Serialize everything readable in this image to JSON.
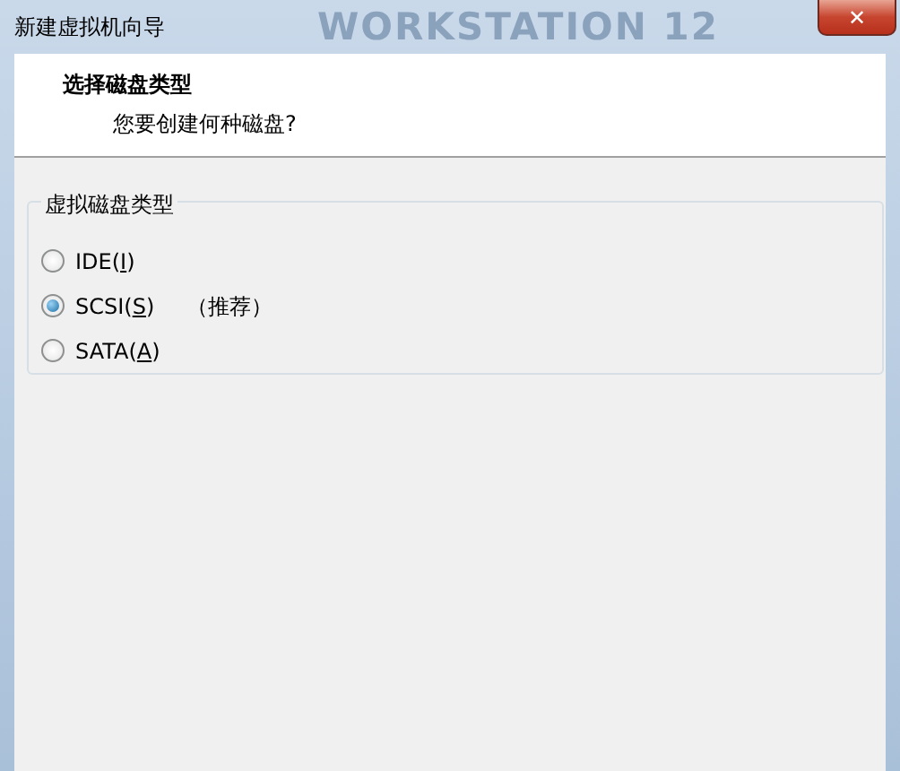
{
  "window": {
    "title": "新建虚拟机向导",
    "brand": "WORKSTATION 12",
    "close": "✕"
  },
  "header": {
    "title": "选择磁盘类型",
    "subtitle": "您要创建何种磁盘?"
  },
  "group": {
    "title": "虚拟磁盘类型",
    "options": [
      {
        "label": "IDE(",
        "mnemonic": "I",
        "suffix": ")",
        "selected": false
      },
      {
        "label": "SCSI(",
        "mnemonic": "S",
        "suffix": ")",
        "note": "（推荐）",
        "selected": true
      },
      {
        "label": "SATA(",
        "mnemonic": "A",
        "suffix": ")",
        "selected": false
      }
    ]
  }
}
